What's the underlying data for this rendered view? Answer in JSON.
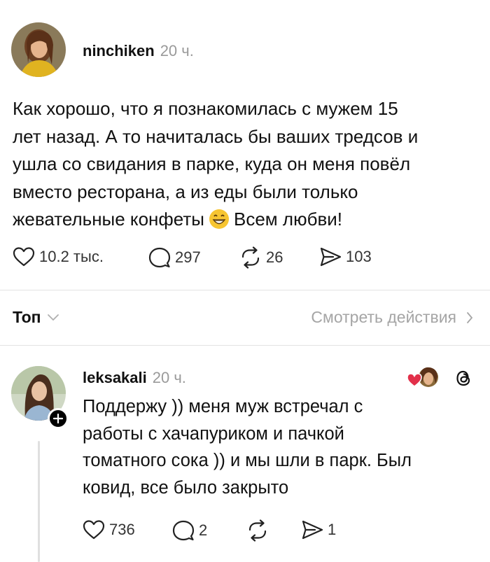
{
  "post": {
    "username": "ninchiken",
    "time": "20 ч.",
    "text_lines": [
      "Как хорошо, что я познакомилась с мужем 15",
      "лет назад. А то начиталась бы ваших тредсов и",
      "ушла со свидания в парке, куда он меня повёл",
      "вместо ресторана, а из еды были только",
      "жевательные конфеты"
    ],
    "text_after_emoji": "Всем любви!",
    "emoji": "grinning-face-emoji",
    "likes": "10.2 тыс.",
    "comments": "297",
    "reposts": "26",
    "shares": "103"
  },
  "sort_bar": {
    "sort_label": "Топ",
    "activity_label": "Смотреть действия"
  },
  "reply": {
    "username": "leksakali",
    "time": "20 ч.",
    "text_lines": [
      "Поддержу )) меня муж встречал с",
      "работы с хачапуриком и пачкой",
      "томатного сока )) и мы шли в парк. Был",
      "ковид, все было закрыто"
    ],
    "likes": "736",
    "comments": "2",
    "shares": "1"
  },
  "colors": {
    "text": "#111111",
    "muted": "#9a9a9a",
    "divider": "#e3e3e3",
    "heart_red": "#e2304a"
  }
}
